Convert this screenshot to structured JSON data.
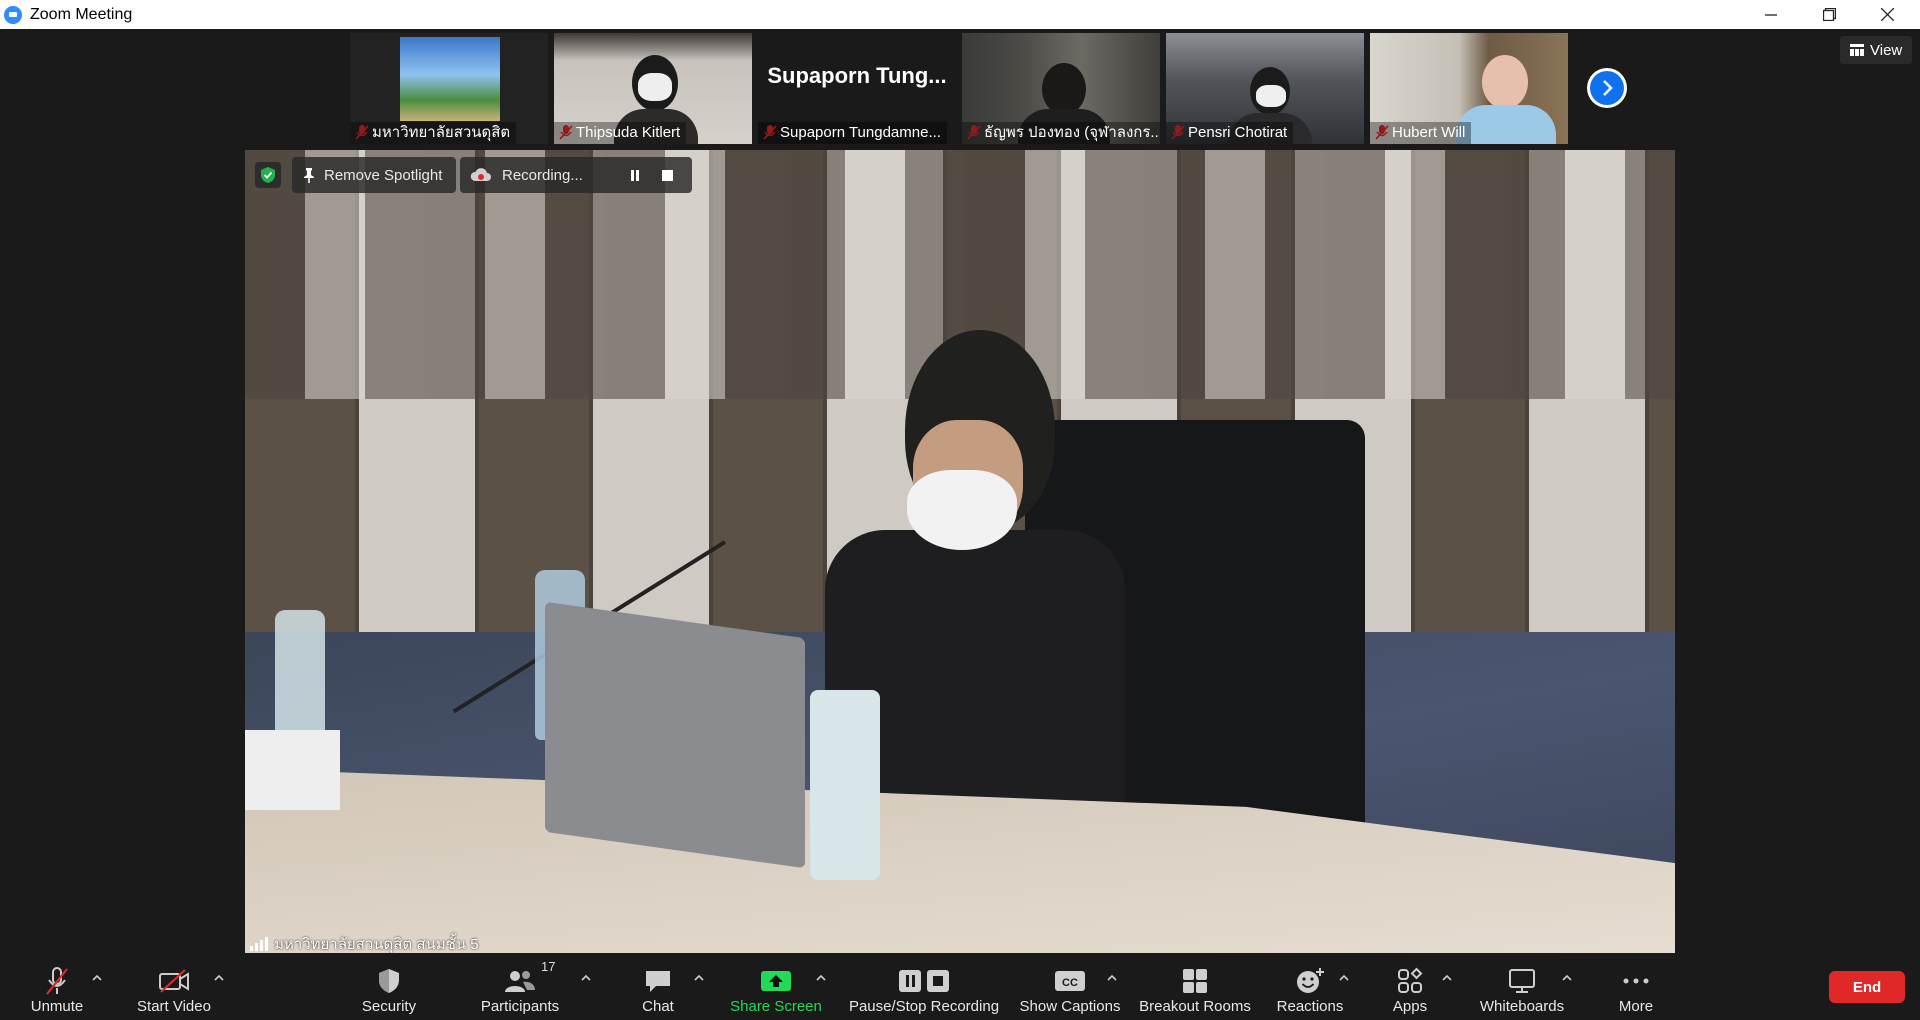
{
  "window": {
    "title": "Zoom Meeting"
  },
  "strip": {
    "participants": [
      {
        "name": "มหาวิทยาลัยสวนดุสิต",
        "muted": true
      },
      {
        "name": "Thipsuda Kitlert",
        "muted": true
      },
      {
        "name": "Supaporn Tungdamne...",
        "big_name": "Supaporn Tung...",
        "muted": true
      },
      {
        "name": "ธัญพร ปองทอง (จุฬาลงกร...",
        "muted": true
      },
      {
        "name": "Pensri Chotirat",
        "muted": true
      },
      {
        "name": "Hubert Will",
        "muted": true
      }
    ],
    "view_label": "View"
  },
  "video": {
    "remove_spotlight": "Remove Spotlight",
    "recording": "Recording...",
    "speaker_name": "มหาวิทยาลัยสวนดุสิต สนมชั้น 5"
  },
  "toolbar": {
    "unmute": "Unmute",
    "start_video": "Start Video",
    "security": "Security",
    "participants": "Participants",
    "participants_count": "17",
    "chat": "Chat",
    "share_screen": "Share Screen",
    "pause_stop_recording": "Pause/Stop Recording",
    "show_captions": "Show Captions",
    "breakout_rooms": "Breakout Rooms",
    "reactions": "Reactions",
    "apps": "Apps",
    "whiteboards": "Whiteboards",
    "more": "More",
    "end": "End"
  },
  "colors": {
    "accent": "#0e72ed",
    "share_green": "#23d959",
    "end_red": "#e02828",
    "mute_red": "#e02828"
  }
}
